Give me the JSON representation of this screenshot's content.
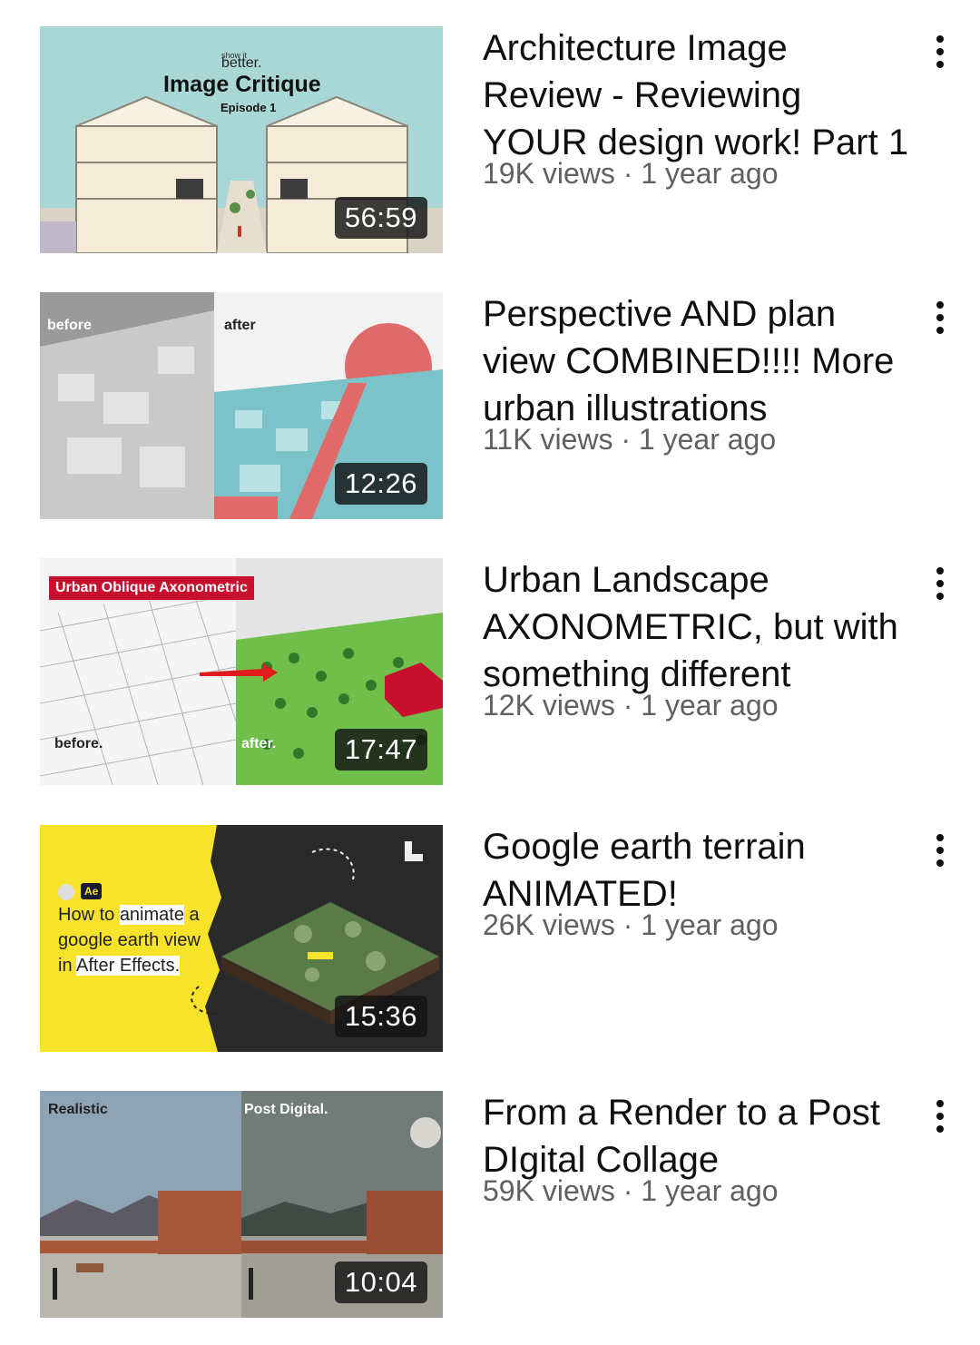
{
  "videos": [
    {
      "title": "Architecture Image Review - Reviewing YOUR design work! Part 1",
      "views": "19K views",
      "age": "1 year ago",
      "separator": "·",
      "duration": "56:59",
      "thumb_text": {
        "brand_small": "show it",
        "brand": "better.",
        "heading": "Image Critique",
        "episode": "Episode 1"
      },
      "thumb_colors": {
        "sky": "#a8d7d6"
      }
    },
    {
      "title": "Perspective AND plan view COMBINED!!!! More urban illustrations",
      "views": "11K views",
      "age": "1 year ago",
      "separator": "·",
      "duration": "12:26",
      "thumb_text": {
        "left": "before",
        "right": "after"
      },
      "thumb_colors": {
        "sun": "#e06a6a",
        "city": "#7cc3c9"
      }
    },
    {
      "title": "Urban Landscape AXONOMETRIC, but with something different",
      "views": "12K views",
      "age": "1 year ago",
      "separator": "·",
      "duration": "17:47",
      "thumb_text": {
        "banner": "Urban Oblique Axonometric",
        "left": "before.",
        "right": "after."
      },
      "thumb_colors": {
        "banner": "#c8102e",
        "green": "#6fbf4a"
      }
    },
    {
      "title": "Google earth terrain ANIMATED!",
      "views": "26K views",
      "age": "1 year ago",
      "separator": "·",
      "duration": "15:36",
      "thumb_text": {
        "badge": "Ae",
        "line1_a": "How to ",
        "line1_b": "animate",
        "line1_c": " a",
        "line2": "google earth view",
        "line3_a": "in ",
        "line3_b": "After Effects."
      },
      "thumb_colors": {
        "yellow": "#f7e42a",
        "dark": "#2a2a2a"
      }
    },
    {
      "title": "From a Render to a Post DIgital Collage",
      "views": "59K views",
      "age": "1 year ago",
      "separator": "·",
      "duration": "10:04",
      "thumb_text": {
        "left": "Realistic",
        "right": "Post Digital."
      },
      "thumb_colors": {
        "sky_left": "#8ea3b3",
        "sky_right": "#6f7c78"
      }
    }
  ]
}
